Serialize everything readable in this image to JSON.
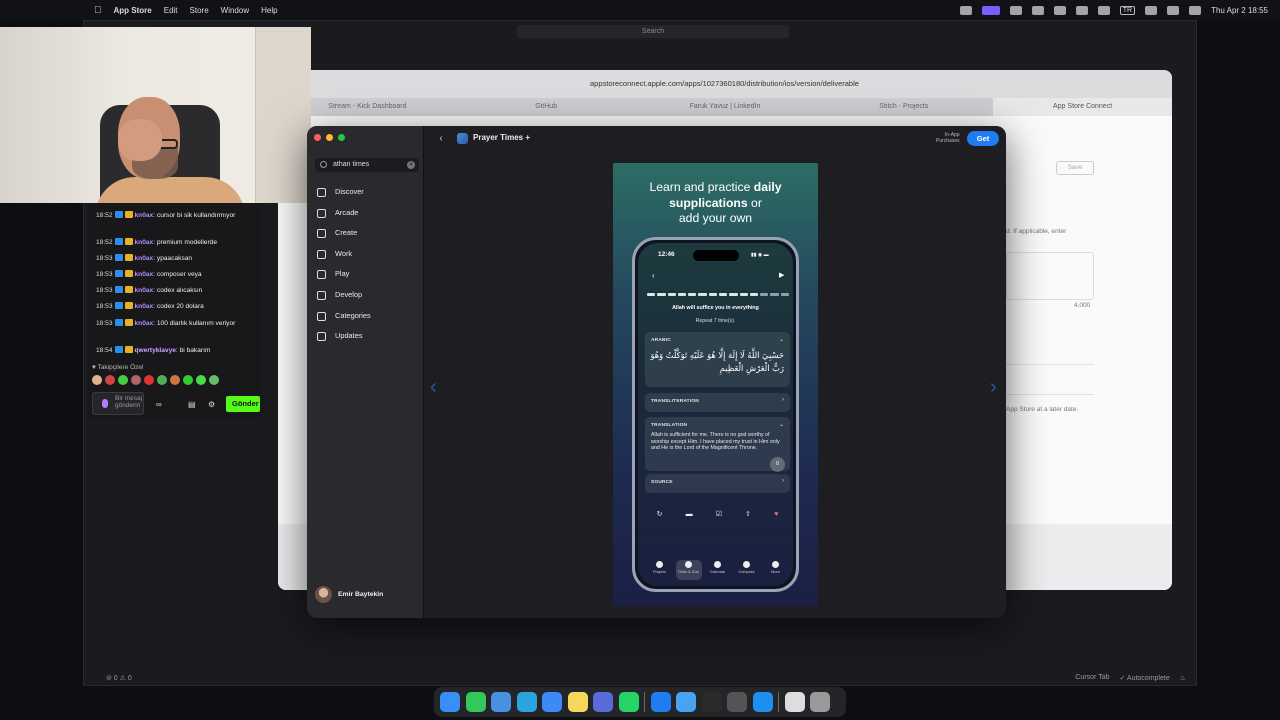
{
  "menubar": {
    "app": "App Store",
    "menus": [
      "Edit",
      "Store",
      "Window",
      "Help"
    ],
    "lang": "TR",
    "datetime": "Thu Apr 2  18:55"
  },
  "editor": {
    "search_placeholder": "Search",
    "status_left": "⊘ 0 ⚠ 0",
    "status_cursor_tab": "Cursor Tab",
    "status_autocomplete": "✓ Autocomplete"
  },
  "safari": {
    "url": "appstoreconnect.apple.com/apps/1027360180/distribution/ios/version/deliverable",
    "tabs": [
      "Stream - Kick Dashboard",
      "GitHub",
      "Faruk Yavuz | LinkedIn",
      "Stitch - Projects",
      "App Store Connect"
    ],
    "save_label": "Save",
    "hint_text": "d. If applicable, enter",
    "char_limit": "4,000",
    "later_text": "App Store at a later date."
  },
  "chat": {
    "messages": [
      {
        "time": "18:52",
        "user": "kn0ax",
        "text": "cursor bi sik kullandırmıyor"
      },
      {
        "time": "18:52",
        "user": "kn0ax",
        "text": "premium modellerde"
      },
      {
        "time": "18:53",
        "user": "kn0ax",
        "text": "ypaacaksan"
      },
      {
        "time": "18:53",
        "user": "kn0ax",
        "text": "composer veya"
      },
      {
        "time": "18:53",
        "user": "kn0ax",
        "text": "codex alıcaksın"
      },
      {
        "time": "18:53",
        "user": "kn0ax",
        "text": "codex 20 dolara"
      },
      {
        "time": "18:53",
        "user": "kn0ax",
        "text": "100 dlarlık kullanım veriyor"
      },
      {
        "time": "18:54",
        "user": "qwertyklavye",
        "text": "bi bakarım"
      }
    ],
    "followers_label": "Takipçilere Özel",
    "input_placeholder": "Bir mesaj gönderin",
    "send_label": "Gönder"
  },
  "appstore": {
    "search_value": "athan times",
    "nav": [
      "Discover",
      "Arcade",
      "Create",
      "Work",
      "Play",
      "Develop",
      "Categories",
      "Updates"
    ],
    "profile_name": "Emir Baytekin",
    "app_name": "Prayer Times +",
    "iap_line1": "In-App",
    "iap_line2": "Purchases",
    "get_label": "Get"
  },
  "screenshot": {
    "title_pre": "Learn and practice ",
    "title_bold1": "daily",
    "title_bold2": "supplications",
    "title_post": " or",
    "title_line3": "add your own",
    "phone_time": "12:46",
    "status_icons": "▮▮ ◉ ▬",
    "subtitle": "Allah will suffice you in everything",
    "repeat": "Repeat 7 time(s).",
    "arabic_label": "ARABIC",
    "arabic_text": "حَسْبِيَ اللَّهُ لَا إِلَهَ إِلَّا هُوَ عَلَيْهِ تَوَكَّلْتُ وَهُوَ رَبُّ الْعَرْشِ الْعَظِيمِ",
    "transliteration_label": "TRANSLITERATION",
    "translation_label": "TRANSLATION",
    "translation_text": "Allah is sufficient for me. There is no god worthy of worship except Him. I have placed my trust in Him only and He is the Lord of the Magnificent Throne.",
    "source_label": "SOURCE",
    "fab_label": "0",
    "tabs": [
      "Prayers",
      "Dhikr & Dua",
      "Calendar",
      "Compass",
      "More"
    ]
  }
}
